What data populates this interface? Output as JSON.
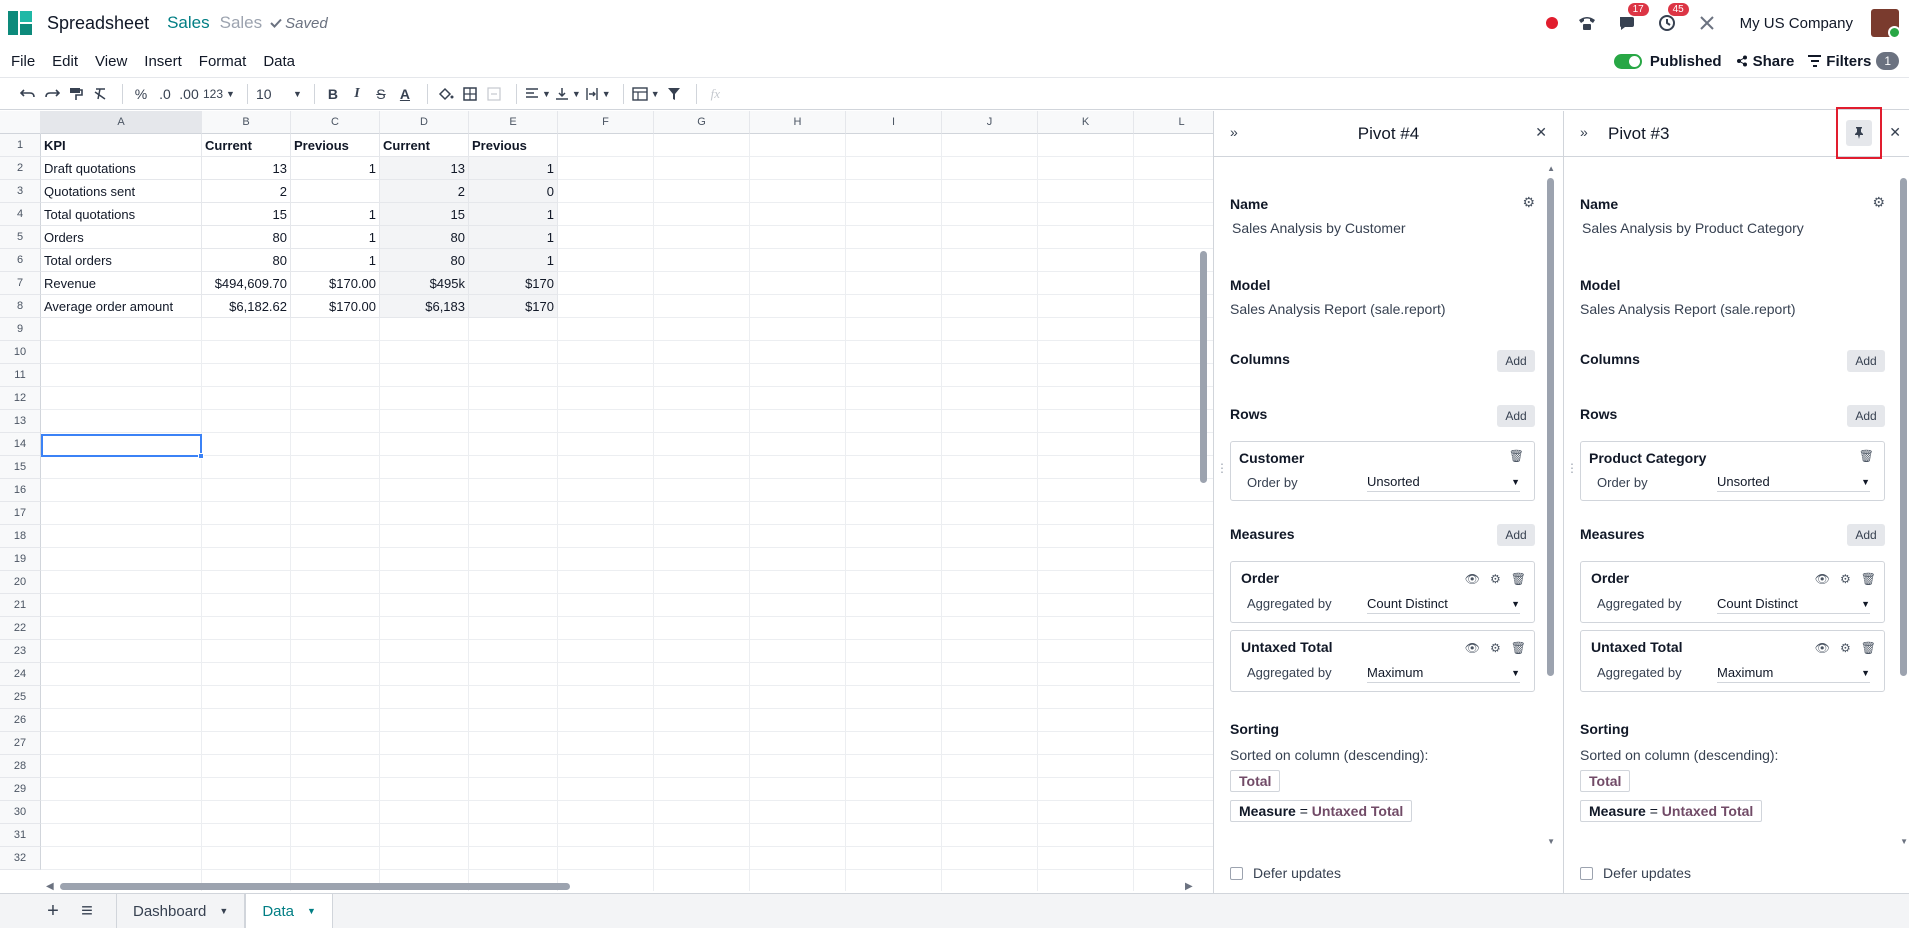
{
  "header": {
    "app_title": "Spreadsheet",
    "breadcrumb_active": "Sales",
    "breadcrumb_name": "Sales",
    "saved_status": "Saved",
    "messages_count": "17",
    "activities_count": "45",
    "company": "My US Company"
  },
  "menu": {
    "items": [
      "File",
      "Edit",
      "View",
      "Insert",
      "Format",
      "Data"
    ],
    "published_label": "Published",
    "share_label": "Share",
    "filters_label": "Filters",
    "filters_count": "1"
  },
  "toolbar": {
    "percent": "%",
    "dec_less": ".0",
    "dec_more": ".00",
    "format_more": "123",
    "font_size": "10",
    "bold": "B",
    "italic": "I",
    "strike": "S",
    "text_color": "A",
    "formula_placeholder": "fx"
  },
  "grid": {
    "columns": [
      "A",
      "B",
      "C",
      "D",
      "E",
      "F",
      "G",
      "H",
      "I",
      "J",
      "K",
      "L"
    ],
    "row_numbers": [
      "1",
      "2",
      "3",
      "4",
      "5",
      "6",
      "7",
      "8",
      "9",
      "10",
      "11",
      "12",
      "13",
      "14",
      "15",
      "16",
      "17",
      "18",
      "19",
      "20",
      "21",
      "22",
      "23",
      "24",
      "25",
      "26",
      "27",
      "28",
      "29",
      "30",
      "31",
      "32"
    ],
    "rows": [
      [
        "KPI",
        "Current",
        "Previous",
        "Current",
        "Previous"
      ],
      [
        "Draft quotations",
        "13",
        "1",
        "13",
        "1"
      ],
      [
        "Quotations sent",
        "2",
        "",
        "2",
        "0"
      ],
      [
        "Total quotations",
        "15",
        "1",
        "15",
        "1"
      ],
      [
        "Orders",
        "80",
        "1",
        "80",
        "1"
      ],
      [
        "Total orders",
        "80",
        "1",
        "80",
        "1"
      ],
      [
        "Revenue",
        "$494,609.70",
        "$170.00",
        "$495k",
        "$170"
      ],
      [
        "Average order amount",
        "$6,182.62",
        "$170.00",
        "$6,183",
        "$170"
      ]
    ]
  },
  "sheets": {
    "tabs": [
      "Dashboard",
      "Data"
    ],
    "active": "Data"
  },
  "panels": [
    {
      "title": "Pivot #4",
      "name_label": "Name",
      "name_value": "Sales Analysis by Customer",
      "model_label": "Model",
      "model_value": "Sales Analysis Report (sale.report)",
      "columns_label": "Columns",
      "rows_label": "Rows",
      "row_field": "Customer",
      "order_by_label": "Order by",
      "order_by_value": "Unsorted",
      "measures_label": "Measures",
      "measures": [
        {
          "name": "Order",
          "agg_label": "Aggregated by",
          "agg_value": "Count Distinct"
        },
        {
          "name": "Untaxed Total",
          "agg_label": "Aggregated by",
          "agg_value": "Maximum"
        }
      ],
      "add_label": "Add",
      "sorting_label": "Sorting",
      "sorting_desc": "Sorted on column (descending):",
      "sort_tag_1": "Total",
      "sort_tag_2_key": "Measure",
      "sort_tag_2_eq": " = ",
      "sort_tag_2_val": "Untaxed Total",
      "defer_label": "Defer updates"
    },
    {
      "title": "Pivot #3",
      "name_label": "Name",
      "name_value": "Sales Analysis by Product Category",
      "model_label": "Model",
      "model_value": "Sales Analysis Report (sale.report)",
      "columns_label": "Columns",
      "rows_label": "Rows",
      "row_field": "Product Category",
      "order_by_label": "Order by",
      "order_by_value": "Unsorted",
      "measures_label": "Measures",
      "measures": [
        {
          "name": "Order",
          "agg_label": "Aggregated by",
          "agg_value": "Count Distinct"
        },
        {
          "name": "Untaxed Total",
          "agg_label": "Aggregated by",
          "agg_value": "Maximum"
        }
      ],
      "add_label": "Add",
      "sorting_label": "Sorting",
      "sorting_desc": "Sorted on column (descending):",
      "sort_tag_1": "Total",
      "sort_tag_2_key": "Measure",
      "sort_tag_2_eq": " = ",
      "sort_tag_2_val": "Untaxed Total",
      "defer_label": "Defer updates"
    }
  ],
  "colors": {
    "accent": "#017e84",
    "purple": "#714b67",
    "highlight_red": "#e11d2e",
    "toggle_on": "#28a745"
  }
}
